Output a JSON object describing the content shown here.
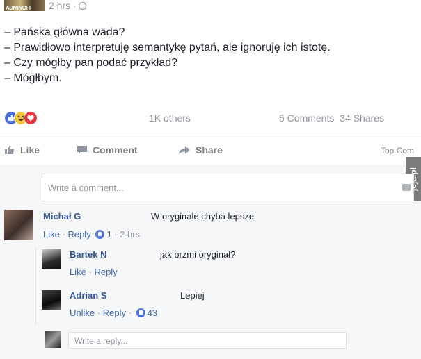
{
  "post": {
    "page_avatar_text": "ADMINOFF",
    "time": "2 hrs ·",
    "lines": [
      "– Pańska główna wada?",
      "– Prawidłowo interpretuję semantykę pytań, ale ignoruję ich istotę.",
      "– Czy mógłby pan podać przykład?",
      "– Mógłbym."
    ],
    "reactions_others": "1K others",
    "comments_count": "5 Comments",
    "shares_count": "34 Shares"
  },
  "actions": {
    "like": "Like",
    "comment": "Comment",
    "share": "Share",
    "top_comments": "Top Com"
  },
  "watermark": "jeja.pl",
  "comment_box": {
    "placeholder": "Write a comment..."
  },
  "comments": [
    {
      "name": "Michał G",
      "text": "W oryginale chyba lepsze.",
      "like": "Like",
      "reply": "Reply",
      "likes": "1",
      "time": "· 2 hrs"
    }
  ],
  "replies": [
    {
      "name": "Bartek N",
      "text": "jak brzmi oryginał?",
      "like": "Like",
      "reply": "Reply"
    },
    {
      "name": "Adrian S",
      "text": "Lepiej",
      "like": "Unlike",
      "reply": "Reply",
      "likes": "43"
    }
  ],
  "reply_box": {
    "placeholder": "Write a reply..."
  },
  "colors": {
    "link": "#365899",
    "like_blue": "#4d6fd1",
    "love_red": "#e6373f",
    "haha_yellow": "#f4c43a",
    "grey_text": "#90949c"
  }
}
